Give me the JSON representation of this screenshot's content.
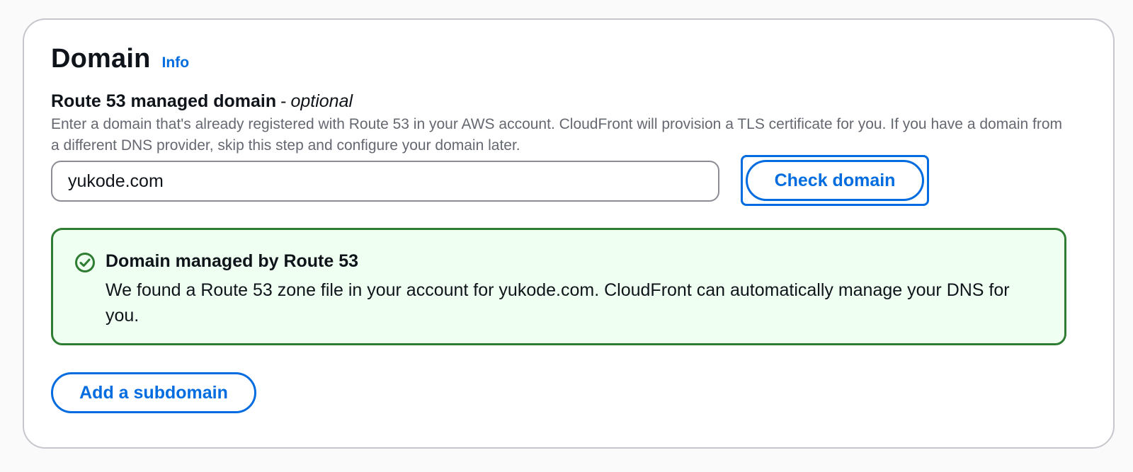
{
  "section": {
    "title": "Domain",
    "info_link": "Info"
  },
  "field": {
    "label": "Route 53 managed domain",
    "label_separator": "-",
    "label_optional": "optional",
    "description": "Enter a domain that's already registered with Route 53 in your AWS account. CloudFront will provision a TLS certificate for you. If you have a domain from a different DNS provider, skip this step and configure your domain later.",
    "value": "yukode.com"
  },
  "buttons": {
    "check_domain": "Check domain",
    "add_subdomain": "Add a subdomain"
  },
  "alert": {
    "type": "success",
    "icon": "check-circle-icon",
    "title": "Domain managed by Route 53",
    "message": "We found a Route 53 zone file in your account for yukode.com. CloudFront can automatically manage your DNS for you."
  },
  "colors": {
    "link": "#006ce0",
    "success_border": "#2e7d32",
    "success_bg": "#effff1"
  }
}
